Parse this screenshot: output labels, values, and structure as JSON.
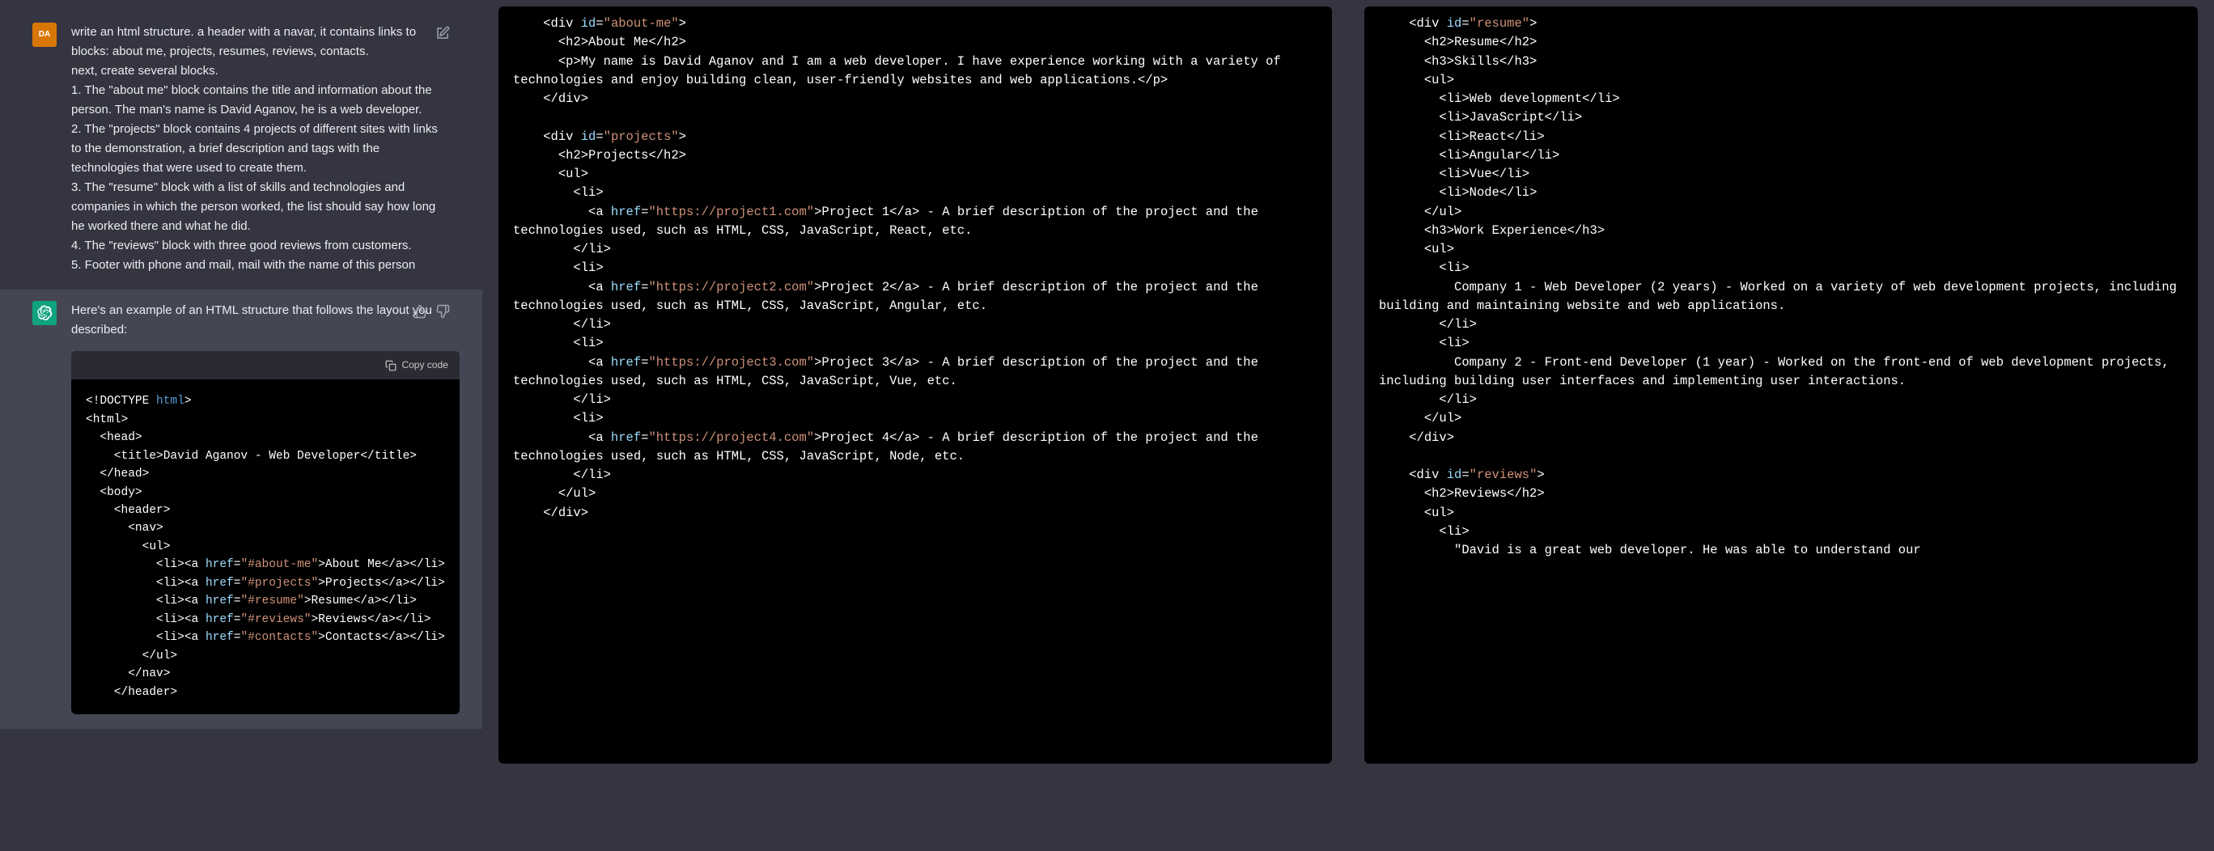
{
  "chat": {
    "user_avatar": "DA",
    "user_message": "write an html structure. a header with a navar, it contains links to blocks: about me, projects, resumes, reviews, contacts.\nnext, create several blocks.\n1. The \"about me\" block contains the title and information about the person. The man's name is David Aganov, he is a web developer.\n2. The \"projects\" block contains 4 projects of different sites with links to the demonstration, a brief description and tags with the technologies that were used to create them.\n3. The \"resume\" block with a list of skills and technologies and companies in which the person worked, the list should say how long he worked there and what he did.\n4. The \"reviews\" block with three good reviews from customers.\n5. Footer with phone and mail, mail with the name of this person",
    "ai_message": "Here's an example of an HTML structure that follows the layout you described:",
    "copy_label": "Copy code"
  },
  "code_left": [
    {
      "t": "doc",
      "s": "<!DOCTYPE "
    },
    {
      "t": "key",
      "s": "html"
    },
    {
      "t": "doc",
      "s": ">\n"
    },
    {
      "t": "tag",
      "s": "<html>\n"
    },
    {
      "t": "tag",
      "s": "  <head>\n"
    },
    {
      "t": "tag",
      "s": "    <title>"
    },
    {
      "t": "txt",
      "s": "David Aganov - Web Developer"
    },
    {
      "t": "tag",
      "s": "</title>\n"
    },
    {
      "t": "tag",
      "s": "  </head>\n"
    },
    {
      "t": "tag",
      "s": "  <body>\n"
    },
    {
      "t": "tag",
      "s": "    <header>\n"
    },
    {
      "t": "tag",
      "s": "      <nav>\n"
    },
    {
      "t": "tag",
      "s": "        <ul>\n"
    },
    {
      "t": "tag",
      "s": "          <li><a "
    },
    {
      "t": "attr",
      "s": "href"
    },
    {
      "t": "tag",
      "s": "="
    },
    {
      "t": "str",
      "s": "\"#about-me\""
    },
    {
      "t": "tag",
      "s": ">About Me</a></li>\n"
    },
    {
      "t": "tag",
      "s": "          <li><a "
    },
    {
      "t": "attr",
      "s": "href"
    },
    {
      "t": "tag",
      "s": "="
    },
    {
      "t": "str",
      "s": "\"#projects\""
    },
    {
      "t": "tag",
      "s": ">Projects</a></li>\n"
    },
    {
      "t": "tag",
      "s": "          <li><a "
    },
    {
      "t": "attr",
      "s": "href"
    },
    {
      "t": "tag",
      "s": "="
    },
    {
      "t": "str",
      "s": "\"#resume\""
    },
    {
      "t": "tag",
      "s": ">Resume</a></li>\n"
    },
    {
      "t": "tag",
      "s": "          <li><a "
    },
    {
      "t": "attr",
      "s": "href"
    },
    {
      "t": "tag",
      "s": "="
    },
    {
      "t": "str",
      "s": "\"#reviews\""
    },
    {
      "t": "tag",
      "s": ">Reviews</a></li>\n"
    },
    {
      "t": "tag",
      "s": "          <li><a "
    },
    {
      "t": "attr",
      "s": "href"
    },
    {
      "t": "tag",
      "s": "="
    },
    {
      "t": "str",
      "s": "\"#contacts\""
    },
    {
      "t": "tag",
      "s": ">Contacts</a></li>\n"
    },
    {
      "t": "tag",
      "s": "        </ul>\n"
    },
    {
      "t": "tag",
      "s": "      </nav>\n"
    },
    {
      "t": "tag",
      "s": "    </header>\n"
    }
  ],
  "code_mid": [
    {
      "t": "tag",
      "s": "    <div "
    },
    {
      "t": "attr",
      "s": "id"
    },
    {
      "t": "tag",
      "s": "="
    },
    {
      "t": "str",
      "s": "\"about-me\""
    },
    {
      "t": "tag",
      "s": ">\n"
    },
    {
      "t": "tag",
      "s": "      <h2>"
    },
    {
      "t": "txt",
      "s": "About Me"
    },
    {
      "t": "tag",
      "s": "</h2>\n"
    },
    {
      "t": "tag",
      "s": "      <p>"
    },
    {
      "t": "txt",
      "s": "My name is David Aganov and I am a web developer. I have experience working with a variety of technologies and enjoy building clean, user-friendly websites and web applications."
    },
    {
      "t": "tag",
      "s": "</p>\n"
    },
    {
      "t": "tag",
      "s": "    </div>\n\n"
    },
    {
      "t": "tag",
      "s": "    <div "
    },
    {
      "t": "attr",
      "s": "id"
    },
    {
      "t": "tag",
      "s": "="
    },
    {
      "t": "str",
      "s": "\"projects\""
    },
    {
      "t": "tag",
      "s": ">\n"
    },
    {
      "t": "tag",
      "s": "      <h2>"
    },
    {
      "t": "txt",
      "s": "Projects"
    },
    {
      "t": "tag",
      "s": "</h2>\n"
    },
    {
      "t": "tag",
      "s": "      <ul>\n"
    },
    {
      "t": "tag",
      "s": "        <li>\n"
    },
    {
      "t": "tag",
      "s": "          <a "
    },
    {
      "t": "attr",
      "s": "href"
    },
    {
      "t": "tag",
      "s": "="
    },
    {
      "t": "str",
      "s": "\"https://project1.com\""
    },
    {
      "t": "tag",
      "s": ">"
    },
    {
      "t": "txt",
      "s": "Project 1"
    },
    {
      "t": "tag",
      "s": "</a>"
    },
    {
      "t": "txt",
      "s": " - A brief description of the project and the technologies used, such as HTML, CSS, JavaScript, React, etc.\n"
    },
    {
      "t": "tag",
      "s": "        </li>\n"
    },
    {
      "t": "tag",
      "s": "        <li>\n"
    },
    {
      "t": "tag",
      "s": "          <a "
    },
    {
      "t": "attr",
      "s": "href"
    },
    {
      "t": "tag",
      "s": "="
    },
    {
      "t": "str",
      "s": "\"https://project2.com\""
    },
    {
      "t": "tag",
      "s": ">"
    },
    {
      "t": "txt",
      "s": "Project 2"
    },
    {
      "t": "tag",
      "s": "</a>"
    },
    {
      "t": "txt",
      "s": " - A brief description of the project and the technologies used, such as HTML, CSS, JavaScript, Angular, etc.\n"
    },
    {
      "t": "tag",
      "s": "        </li>\n"
    },
    {
      "t": "tag",
      "s": "        <li>\n"
    },
    {
      "t": "tag",
      "s": "          <a "
    },
    {
      "t": "attr",
      "s": "href"
    },
    {
      "t": "tag",
      "s": "="
    },
    {
      "t": "str",
      "s": "\"https://project3.com\""
    },
    {
      "t": "tag",
      "s": ">"
    },
    {
      "t": "txt",
      "s": "Project 3"
    },
    {
      "t": "tag",
      "s": "</a>"
    },
    {
      "t": "txt",
      "s": " - A brief description of the project and the technologies used, such as HTML, CSS, JavaScript, Vue, etc.\n"
    },
    {
      "t": "tag",
      "s": "        </li>\n"
    },
    {
      "t": "tag",
      "s": "        <li>\n"
    },
    {
      "t": "tag",
      "s": "          <a "
    },
    {
      "t": "attr",
      "s": "href"
    },
    {
      "t": "tag",
      "s": "="
    },
    {
      "t": "str",
      "s": "\"https://project4.com\""
    },
    {
      "t": "tag",
      "s": ">"
    },
    {
      "t": "txt",
      "s": "Project 4"
    },
    {
      "t": "tag",
      "s": "</a>"
    },
    {
      "t": "txt",
      "s": " - A brief description of the project and the technologies used, such as HTML, CSS, JavaScript, Node, etc.\n"
    },
    {
      "t": "tag",
      "s": "        </li>\n"
    },
    {
      "t": "tag",
      "s": "      </ul>\n"
    },
    {
      "t": "tag",
      "s": "    </div>\n"
    }
  ],
  "code_right": [
    {
      "t": "tag",
      "s": "    <div "
    },
    {
      "t": "attr",
      "s": "id"
    },
    {
      "t": "tag",
      "s": "="
    },
    {
      "t": "str",
      "s": "\"resume\""
    },
    {
      "t": "tag",
      "s": ">\n"
    },
    {
      "t": "tag",
      "s": "      <h2>"
    },
    {
      "t": "txt",
      "s": "Resume"
    },
    {
      "t": "tag",
      "s": "</h2>\n"
    },
    {
      "t": "tag",
      "s": "      <h3>"
    },
    {
      "t": "txt",
      "s": "Skills"
    },
    {
      "t": "tag",
      "s": "</h3>\n"
    },
    {
      "t": "tag",
      "s": "      <ul>\n"
    },
    {
      "t": "tag",
      "s": "        <li>"
    },
    {
      "t": "txt",
      "s": "Web development"
    },
    {
      "t": "tag",
      "s": "</li>\n"
    },
    {
      "t": "tag",
      "s": "        <li>"
    },
    {
      "t": "txt",
      "s": "JavaScript"
    },
    {
      "t": "tag",
      "s": "</li>\n"
    },
    {
      "t": "tag",
      "s": "        <li>"
    },
    {
      "t": "txt",
      "s": "React"
    },
    {
      "t": "tag",
      "s": "</li>\n"
    },
    {
      "t": "tag",
      "s": "        <li>"
    },
    {
      "t": "txt",
      "s": "Angular"
    },
    {
      "t": "tag",
      "s": "</li>\n"
    },
    {
      "t": "tag",
      "s": "        <li>"
    },
    {
      "t": "txt",
      "s": "Vue"
    },
    {
      "t": "tag",
      "s": "</li>\n"
    },
    {
      "t": "tag",
      "s": "        <li>"
    },
    {
      "t": "txt",
      "s": "Node"
    },
    {
      "t": "tag",
      "s": "</li>\n"
    },
    {
      "t": "tag",
      "s": "      </ul>\n"
    },
    {
      "t": "tag",
      "s": "      <h3>"
    },
    {
      "t": "txt",
      "s": "Work Experience"
    },
    {
      "t": "tag",
      "s": "</h3>\n"
    },
    {
      "t": "tag",
      "s": "      <ul>\n"
    },
    {
      "t": "tag",
      "s": "        <li>\n"
    },
    {
      "t": "txt",
      "s": "          Company 1 - Web Developer (2 years) - Worked on a variety of web development projects, including building and maintaining website and web applications.\n"
    },
    {
      "t": "tag",
      "s": "        </li>\n"
    },
    {
      "t": "tag",
      "s": "        <li>\n"
    },
    {
      "t": "txt",
      "s": "          Company 2 - Front-end Developer (1 year) - Worked on the front-end of web development projects, including building user interfaces and implementing user interactions.\n"
    },
    {
      "t": "tag",
      "s": "        </li>\n"
    },
    {
      "t": "tag",
      "s": "      </ul>\n"
    },
    {
      "t": "tag",
      "s": "    </div>\n\n"
    },
    {
      "t": "tag",
      "s": "    <div "
    },
    {
      "t": "attr",
      "s": "id"
    },
    {
      "t": "tag",
      "s": "="
    },
    {
      "t": "str",
      "s": "\"reviews\""
    },
    {
      "t": "tag",
      "s": ">\n"
    },
    {
      "t": "tag",
      "s": "      <h2>"
    },
    {
      "t": "txt",
      "s": "Reviews"
    },
    {
      "t": "tag",
      "s": "</h2>\n"
    },
    {
      "t": "tag",
      "s": "      <ul>\n"
    },
    {
      "t": "tag",
      "s": "        <li>\n"
    },
    {
      "t": "txt",
      "s": "          \"David is a great web developer. He was able to understand our"
    }
  ]
}
